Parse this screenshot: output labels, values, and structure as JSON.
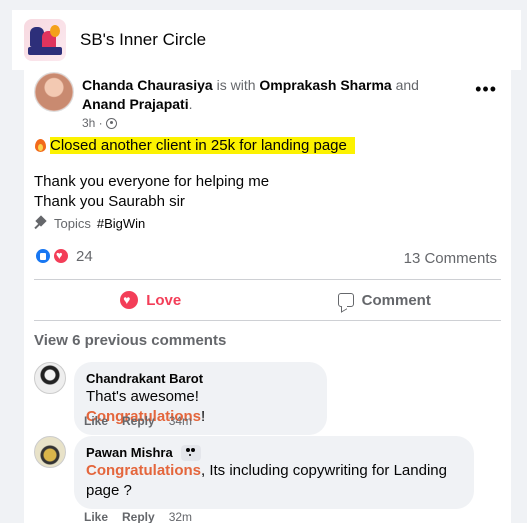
{
  "group": {
    "name": "SB's Inner Circle"
  },
  "post": {
    "author": "Chanda Chaurasiya",
    "with_text": "is with",
    "tagged_1": "Omprakash Sharma",
    "and_text": "and",
    "tagged_2": "Anand Prajapati",
    "time": "3h ·",
    "highlight_text": "Closed another client in 25k for landing page",
    "line_1": "Thank you everyone for helping me",
    "line_2": "Thank you Saurabh sir",
    "topics_label": "Topics",
    "hashtag": "#BigWin",
    "reaction_count": "24",
    "comments_count": "13 Comments"
  },
  "actions": {
    "love": "Love",
    "comment": "Comment"
  },
  "view_previous": "View 6 previous comments",
  "comments": [
    {
      "name": "Chandrakant Barot",
      "text_before": "That's awesome! ",
      "highlight": "Congratulations",
      "text_after": "!",
      "like": "Like",
      "reply": "Reply",
      "time": "34m"
    },
    {
      "name": "Pawan Mishra",
      "highlight": "Congratulations",
      "text_after": ", Its including copywriting for Landing page ?",
      "like": "Like",
      "reply": "Reply",
      "time": "32m"
    }
  ],
  "colors": {
    "accent_blue": "#1877f2",
    "love_red": "#f33e58",
    "mention_orange": "#e4663c",
    "highlight_yellow": "#fcf200"
  }
}
